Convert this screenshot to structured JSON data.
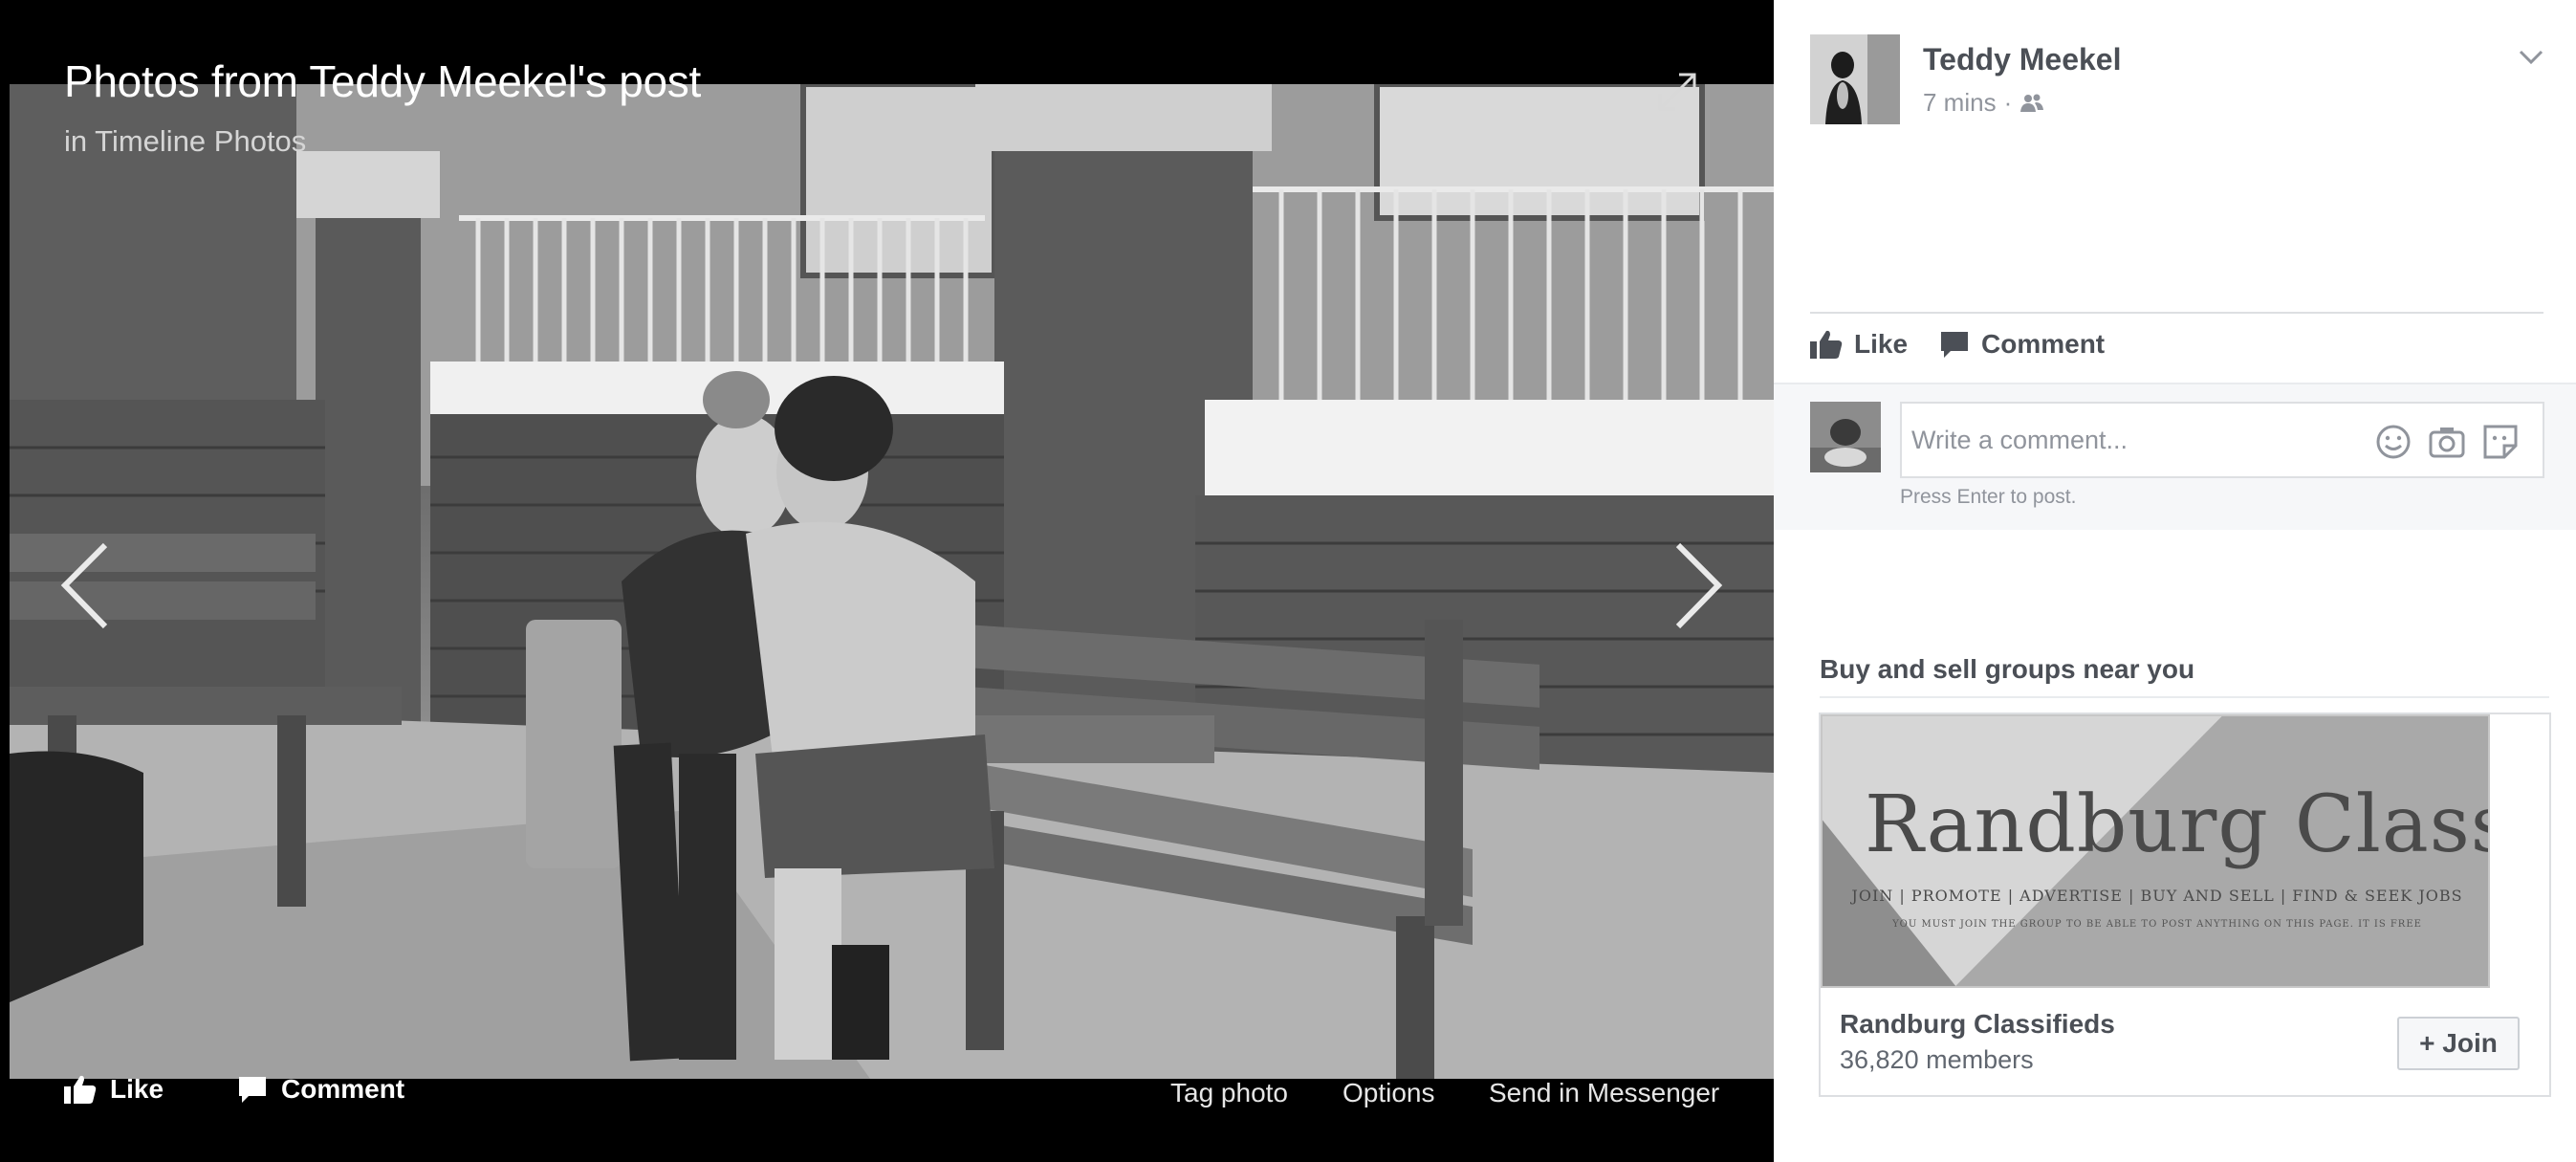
{
  "photo_viewer": {
    "title": "Photos from Teddy Meekel's post",
    "subtitle": "in Timeline Photos",
    "expand_icon": "expand-icon",
    "prev_icon": "chevron-left-icon",
    "next_icon": "chevron-right-icon",
    "bottom_bar": {
      "like_label": "Like",
      "comment_label": "Comment",
      "tag_label": "Tag photo",
      "options_label": "Options",
      "send_label": "Send in Messenger"
    }
  },
  "post": {
    "author": "Teddy Meekel",
    "time": "7 mins",
    "separator": "·",
    "audience_icon": "friends-icon",
    "menu_icon": "chevron-down-icon",
    "actions": {
      "like_label": "Like",
      "comment_label": "Comment"
    },
    "comment_composer": {
      "placeholder": "Write a comment...",
      "hint": "Press Enter to post.",
      "icons": [
        "emoji-icon",
        "camera-icon",
        "sticker-icon"
      ]
    }
  },
  "suggestions": {
    "heading": "Buy and sell groups near you",
    "group": {
      "cover_logo": "Randburg Classifieds",
      "cover_tagline": "JOIN | PROMOTE | ADVERTISE | BUY AND SELL | FIND & SEEK JOBS",
      "cover_note": "YOU MUST JOIN THE GROUP TO BE ABLE TO POST ANYTHING ON THIS PAGE. IT IS FREE",
      "name": "Randburg Classifieds",
      "members": "36,820 members",
      "join_label": "+ Join"
    }
  },
  "colors": {
    "stage_bg": "#000000",
    "text_primary": "#4b4f56",
    "text_secondary": "#90949c",
    "composer_bg": "#f6f7f9",
    "border": "#dddfe2"
  }
}
